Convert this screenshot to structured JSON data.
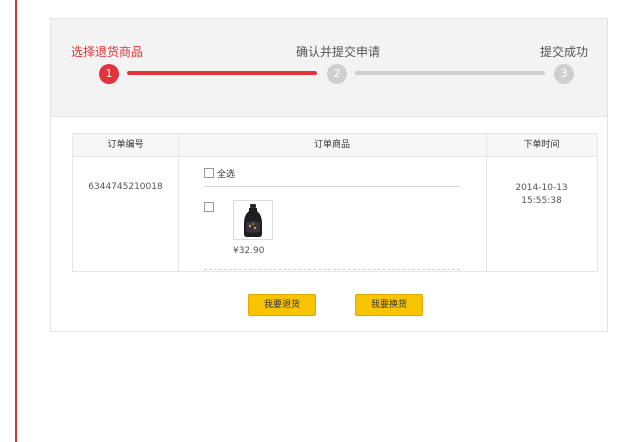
{
  "steps": {
    "step1_label": "选择退货商品",
    "step2_label": "确认并提交申请",
    "step3_label": "提交成功",
    "step1_num": "1",
    "step2_num": "2",
    "step3_num": "3",
    "current_step": 1
  },
  "table": {
    "headers": {
      "order_id": "订单编号",
      "order_goods": "订单商品",
      "order_time": "下单时间"
    },
    "row": {
      "order_id": "6344745210018",
      "select_all": "全选",
      "price": "¥32.90",
      "date": "2014-10-13",
      "time": "15:55:38"
    }
  },
  "actions": {
    "return_label": "我要退货",
    "exchange_label": "我要换货"
  },
  "colors": {
    "accent": "#e2343a",
    "inactive": "#cfcfcf",
    "button": "#f8c400"
  }
}
